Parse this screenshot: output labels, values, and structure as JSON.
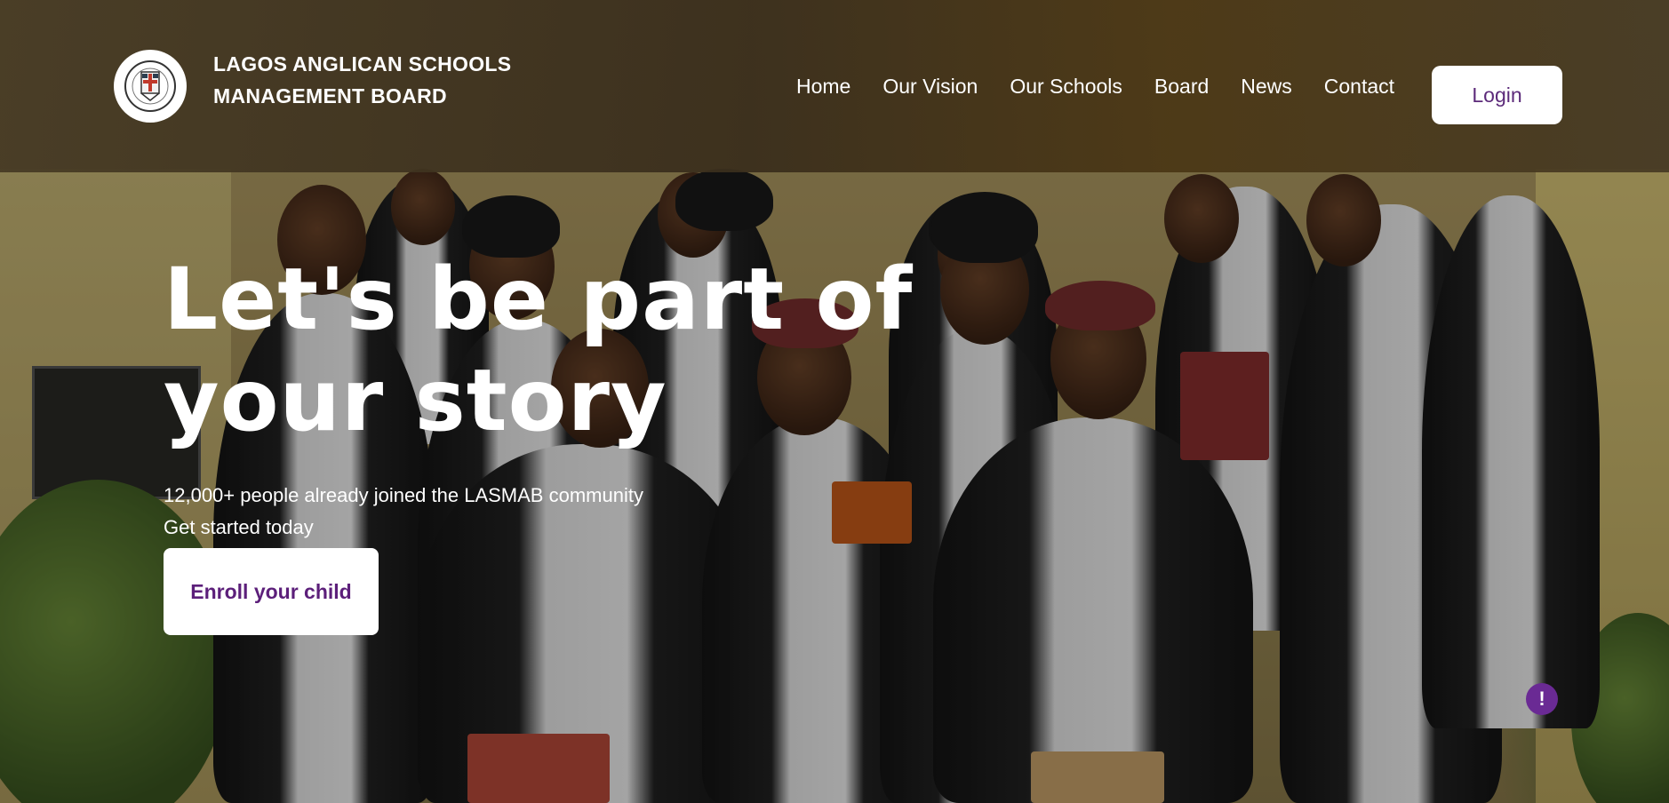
{
  "header": {
    "org_name_line1": "LAGOS ANGLICAN SCHOOLS",
    "org_name_line2": "MANAGEMENT BOARD",
    "logo_icon": "crest-logo-icon"
  },
  "nav": {
    "items": [
      {
        "label": "Home"
      },
      {
        "label": "Our Vision"
      },
      {
        "label": "Our Schools"
      },
      {
        "label": "Board"
      },
      {
        "label": "News"
      },
      {
        "label": "Contact"
      }
    ],
    "login_label": "Login"
  },
  "hero": {
    "headline_line1": "Let's be part of",
    "headline_line2": "your story",
    "subtext_line1": "12,000+ people already joined the LASMAB community",
    "subtext_line2": "Get started today",
    "cta_label": "Enroll your child"
  },
  "feedback": {
    "label": "!",
    "icon": "exclamation-icon"
  },
  "colors": {
    "brand_purple": "#5c1f7a",
    "header_overlay": "#463a24",
    "button_bg": "#ffffff",
    "feedback_bg": "#6a2a94"
  }
}
